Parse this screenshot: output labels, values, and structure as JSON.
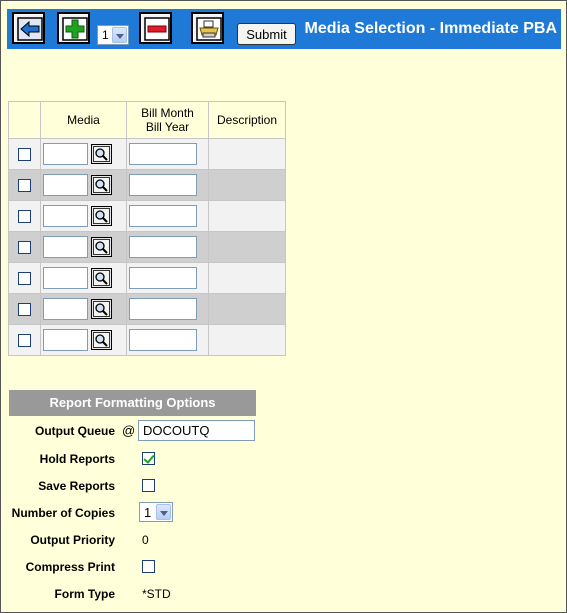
{
  "toolbar": {
    "buttons": [
      {
        "name": "back-button",
        "icon": "arrow-left-icon"
      },
      {
        "name": "add-row-button",
        "icon": "plus-icon"
      },
      {
        "name": "remove-row-button",
        "icon": "minus-icon"
      },
      {
        "name": "print-button",
        "icon": "printer-icon"
      }
    ],
    "row_count_value": "1",
    "submit_label": "Submit",
    "title": "Media Selection - Immediate PBA",
    "background_color": "#1e7ad6"
  },
  "media_table": {
    "headers": [
      "",
      "Media",
      "Bill Month\nBill Year",
      "Description"
    ],
    "header_media": "Media",
    "header_bill_line1": "Bill Month",
    "header_bill_line2": "Bill Year",
    "header_description": "Description",
    "rows": [
      {
        "checked": false,
        "media": "",
        "bill": "",
        "description": ""
      },
      {
        "checked": false,
        "media": "",
        "bill": "",
        "description": ""
      },
      {
        "checked": false,
        "media": "",
        "bill": "",
        "description": ""
      },
      {
        "checked": false,
        "media": "",
        "bill": "",
        "description": ""
      },
      {
        "checked": false,
        "media": "",
        "bill": "",
        "description": ""
      },
      {
        "checked": false,
        "media": "",
        "bill": "",
        "description": ""
      },
      {
        "checked": false,
        "media": "",
        "bill": "",
        "description": ""
      }
    ]
  },
  "report_options": {
    "header": "Report Formatting Options",
    "output_queue_label": "Output Queue",
    "output_queue_at": "@",
    "output_queue_value": "DOCOUTQ",
    "hold_reports_label": "Hold Reports",
    "hold_reports_checked": true,
    "save_reports_label": "Save Reports",
    "save_reports_checked": false,
    "number_of_copies_label": "Number of Copies",
    "number_of_copies_value": "1",
    "output_priority_label": "Output Priority",
    "output_priority_value": "0",
    "compress_print_label": "Compress Print",
    "compress_print_checked": false,
    "form_type_label": "Form Type",
    "form_type_value": "*STD"
  }
}
